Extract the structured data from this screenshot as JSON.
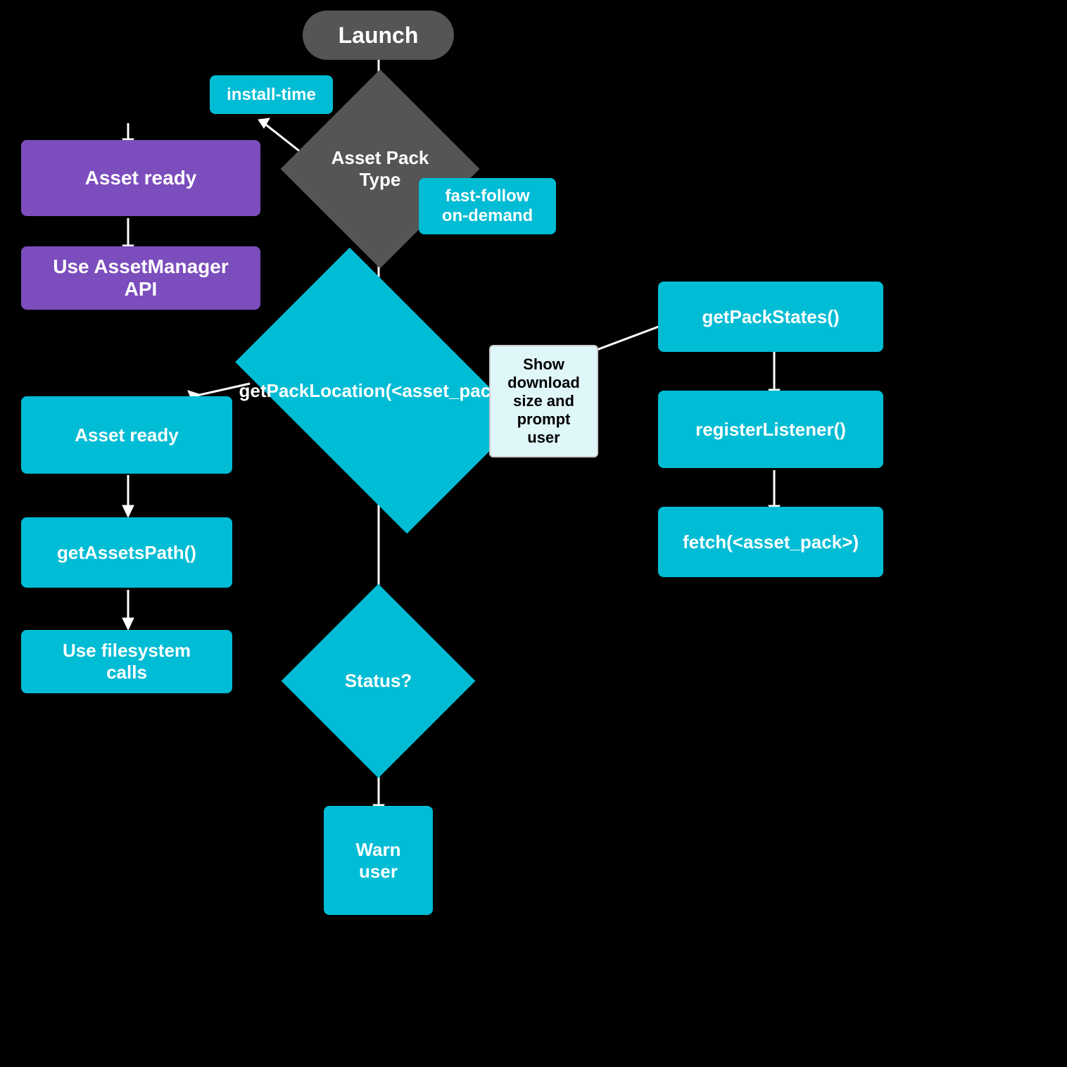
{
  "nodes": {
    "launch": {
      "label": "Launch"
    },
    "assetPackType": {
      "label": "Asset Pack\nType"
    },
    "installTime": {
      "label": "install-time"
    },
    "fastFollow": {
      "label": "fast-follow\non-demand"
    },
    "assetReady1": {
      "label": "Asset ready"
    },
    "useAssetManagerAPI": {
      "label": "Use AssetManager API"
    },
    "getPackLocation": {
      "label": "getPackLocation(<asset_pack>)"
    },
    "assetReady2": {
      "label": "Asset ready"
    },
    "getAssetsPath": {
      "label": "getAssetsPath()"
    },
    "useFilesystemCalls": {
      "label": "Use filesystem calls"
    },
    "showDownload": {
      "label": "Show\ndownload\nsize and\nprompt\nuser"
    },
    "getPackStates": {
      "label": "getPackStates()"
    },
    "registerListener": {
      "label": "registerListener()"
    },
    "fetchAssetPack": {
      "label": "fetch(<asset_pack>)"
    },
    "status": {
      "label": "Status?"
    },
    "warnUser": {
      "label": "Warn\nuser"
    }
  }
}
